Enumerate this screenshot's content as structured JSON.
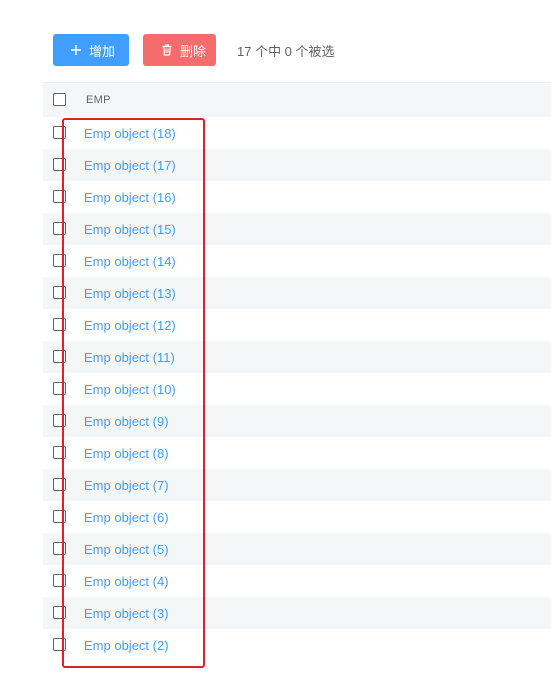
{
  "toolbar": {
    "add_label": "增加",
    "delete_label": "删除",
    "selection_count": "17 个中 0 个被选"
  },
  "table": {
    "column_header": "EMP",
    "rows": [
      "Emp object (18)",
      "Emp object (17)",
      "Emp object (16)",
      "Emp object (15)",
      "Emp object (14)",
      "Emp object (13)",
      "Emp object (12)",
      "Emp object (11)",
      "Emp object (10)",
      "Emp object (9)",
      "Emp object (8)",
      "Emp object (7)",
      "Emp object (6)",
      "Emp object (5)",
      "Emp object (4)",
      "Emp object (3)",
      "Emp object (2)"
    ]
  },
  "colors": {
    "add_button": "#409eff",
    "delete_button": "#f56c6c",
    "link": "#409eff",
    "highlight_box": "#e0202a"
  },
  "icons": {
    "add": "plus-icon",
    "delete": "trash-icon"
  }
}
